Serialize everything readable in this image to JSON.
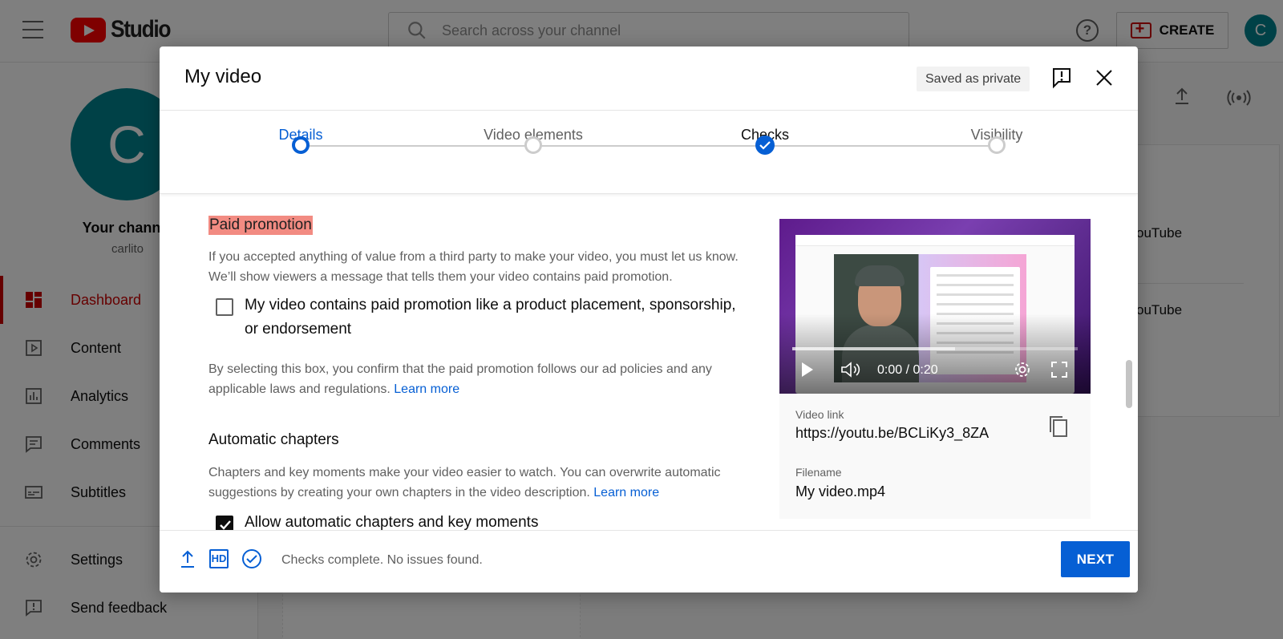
{
  "app": {
    "search_placeholder": "Search across your channel",
    "create_label": "CREATE",
    "avatar_letter": "C"
  },
  "sidebar": {
    "avatar_letter": "C",
    "channel_title": "Your channel",
    "channel_handle": "carlito",
    "items": [
      {
        "label": "Dashboard",
        "icon": "dashboard-icon",
        "active": true
      },
      {
        "label": "Content",
        "icon": "content-icon"
      },
      {
        "label": "Analytics",
        "icon": "analytics-icon"
      },
      {
        "label": "Comments",
        "icon": "comments-icon"
      },
      {
        "label": "Subtitles",
        "icon": "subtitles-icon"
      }
    ],
    "footer_items": [
      {
        "label": "Settings",
        "icon": "gear-icon"
      },
      {
        "label": "Send feedback",
        "icon": "feedback-icon"
      }
    ]
  },
  "background": {
    "card_text_1": "ouTube",
    "card_text_2": "ouTube",
    "card_heading": "o"
  },
  "modal": {
    "title": "My video",
    "saved_badge": "Saved as private",
    "steps": [
      {
        "label": "Details",
        "state": "active"
      },
      {
        "label": "Video elements",
        "state": "pending"
      },
      {
        "label": "Checks",
        "state": "done"
      },
      {
        "label": "Visibility",
        "state": "pending"
      }
    ],
    "paid_promotion": {
      "title": "Paid promotion",
      "description": "If you accepted anything of value from a third party to make your video, you must let us know. We’ll show viewers a message that tells them your video contains paid promotion.",
      "checkbox_label": "My video contains paid promotion like a product placement, sponsorship, or endorsement",
      "checked": false,
      "confirm_text": "By selecting this box, you confirm that the paid promotion follows our ad policies and any applicable laws and regulations.",
      "learn_more": "Learn more"
    },
    "chapters": {
      "title": "Automatic chapters",
      "description": "Chapters and key moments make your video easier to watch. You can overwrite automatic suggestions by creating your own chapters in the video description.",
      "learn_more": "Learn more",
      "checkbox_label": "Allow automatic chapters and key moments",
      "checked": true
    },
    "video": {
      "time": "0:00 / 0:20",
      "progress_buffered": 0.57,
      "link_label": "Video link",
      "link": "https://youtu.be/BCLiKy3_8ZA",
      "filename_label": "Filename",
      "filename": "My video.mp4"
    },
    "footer": {
      "status": "Checks complete. No issues found.",
      "next_label": "NEXT",
      "hd_label": "HD"
    }
  },
  "colors": {
    "accent": "#065fd4",
    "brand_red": "#ff0000",
    "highlight": "#f28b82",
    "avatar": "#00838f"
  }
}
